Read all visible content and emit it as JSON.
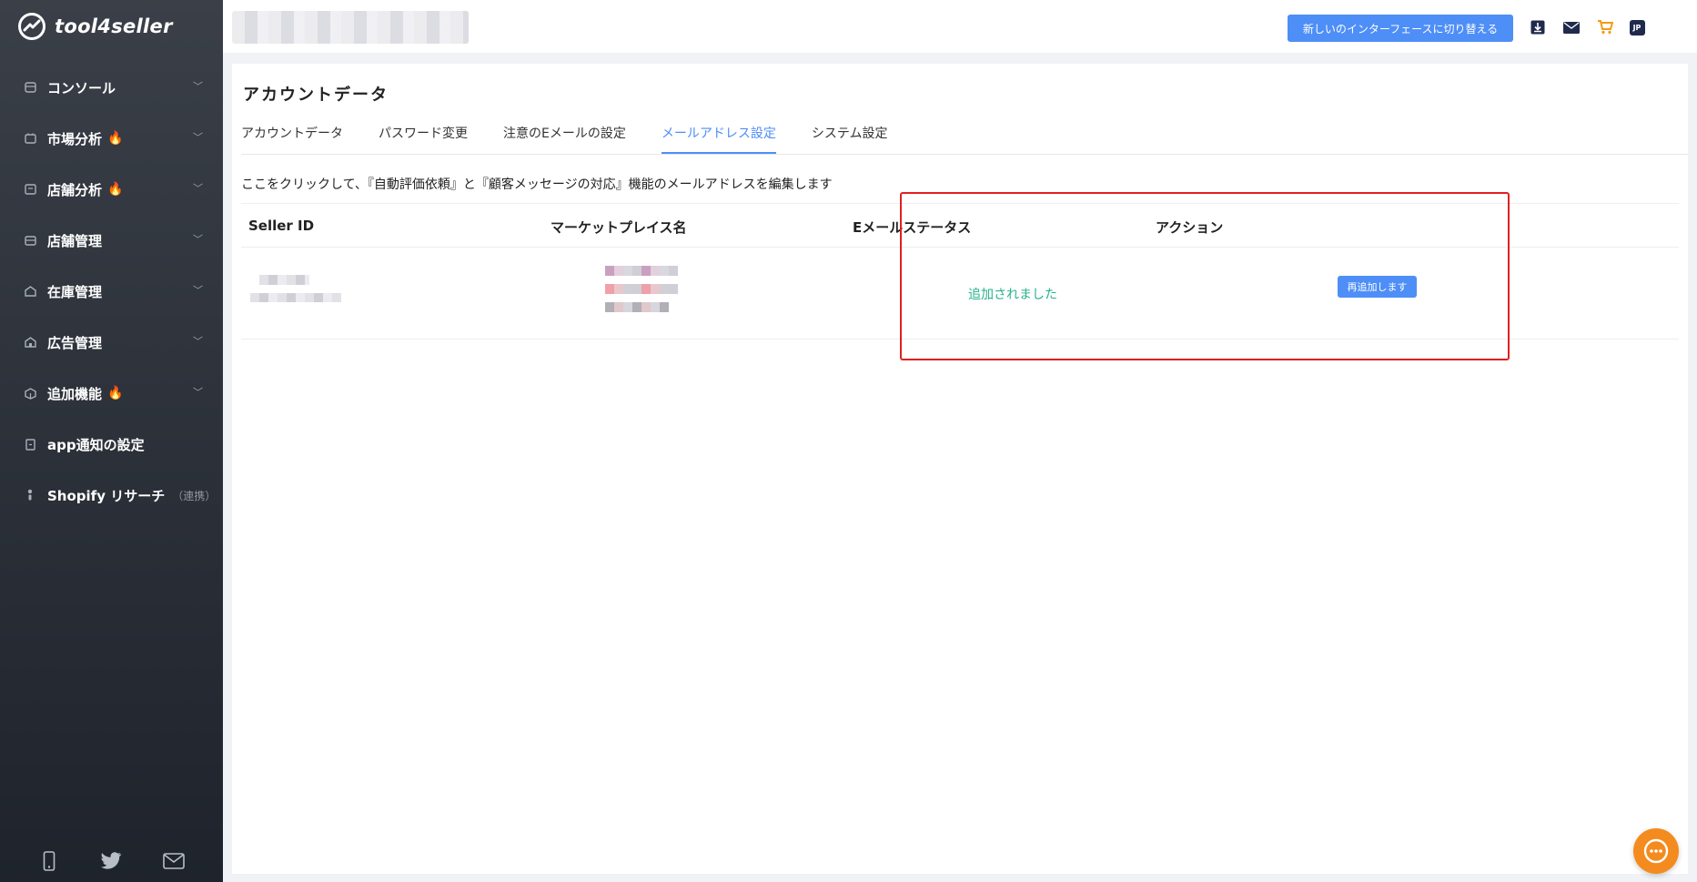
{
  "app": {
    "logo_text": "tool4seller"
  },
  "sidebar": {
    "items": [
      {
        "label": "コンソール",
        "icon": "console-icon",
        "hot": false,
        "chevron": true
      },
      {
        "label": "市場分析",
        "icon": "market-icon",
        "hot": true,
        "chevron": true
      },
      {
        "label": "店舗分析",
        "icon": "store-analysis-icon",
        "hot": true,
        "chevron": true
      },
      {
        "label": "店舗管理",
        "icon": "store-manage-icon",
        "hot": false,
        "chevron": true
      },
      {
        "label": "在庫管理",
        "icon": "inventory-icon",
        "hot": false,
        "chevron": true
      },
      {
        "label": "広告管理",
        "icon": "ads-icon",
        "hot": false,
        "chevron": true
      },
      {
        "label": "追加機能",
        "icon": "addon-icon",
        "hot": true,
        "chevron": true
      },
      {
        "label": "app通知の設定",
        "icon": "app-notify-icon",
        "hot": false,
        "chevron": false
      },
      {
        "label": "Shopify リサーチ",
        "sub": "（連携）",
        "icon": "shopify-icon",
        "hot": false,
        "chevron": false
      }
    ],
    "footer_icons": [
      "phone-icon",
      "twitter-icon",
      "mail-icon"
    ]
  },
  "topbar": {
    "switch_label": "新しいのインターフェースに切り替える",
    "icons": [
      "download-icon",
      "mail-icon",
      "cart-icon",
      "jp-language-icon"
    ],
    "lang_badge": "JP"
  },
  "main": {
    "title": "アカウントデータ",
    "tabs": [
      {
        "label": "アカウントデータ",
        "active": false
      },
      {
        "label": "パスワード変更",
        "active": false
      },
      {
        "label": "注意のEメールの設定",
        "active": false
      },
      {
        "label": "メールアドレス設定",
        "active": true
      },
      {
        "label": "システム設定",
        "active": false
      }
    ],
    "description": "ここをクリックして、『自動評価依頼』と『顧客メッセージの対応』機能のメールアドレスを編集します",
    "table": {
      "columns": [
        "Seller ID",
        "マーケットプレイス名",
        "Eメールステータス",
        "アクション"
      ],
      "rows": [
        {
          "status": "追加されました",
          "action": "再追加します"
        }
      ]
    }
  },
  "colors": {
    "accent": "#4e8ef7",
    "status_green": "#26b28a",
    "highlight_red": "#e02020",
    "hot_flame": "#f25a6e",
    "chat_orange": "#f48b1f"
  }
}
